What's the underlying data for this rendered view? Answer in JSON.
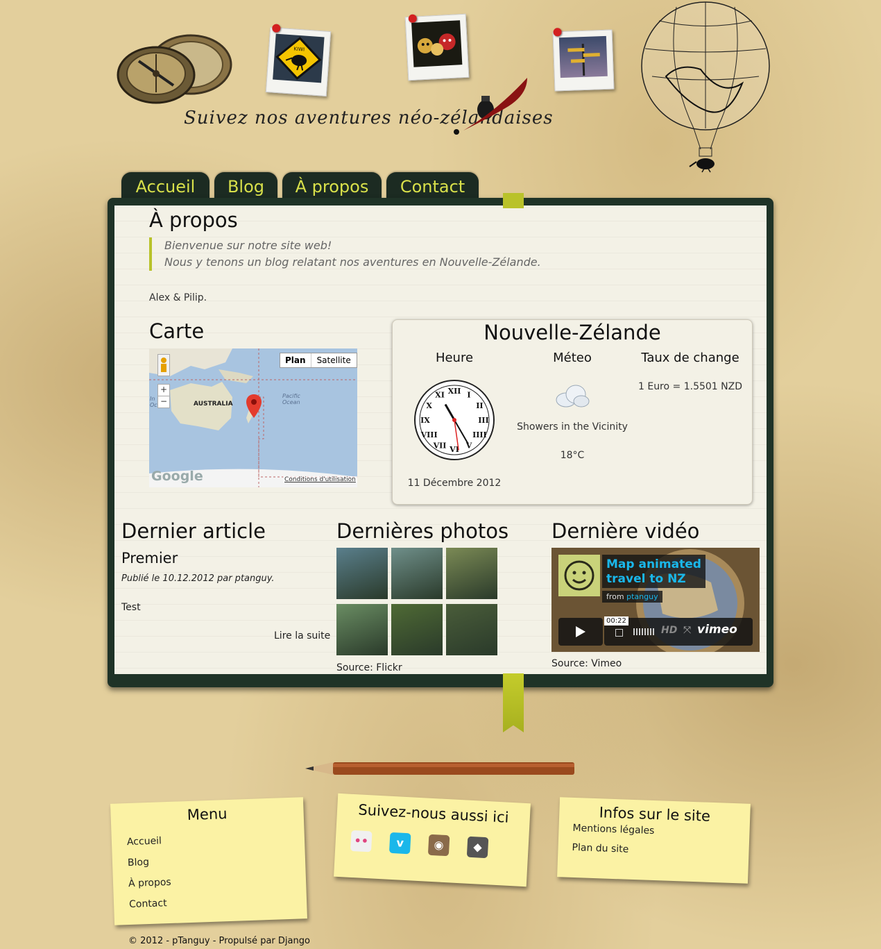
{
  "header": {
    "tagline": "Suivez nos aventures néo-zélandaises",
    "photo_sign_text": "KIWI"
  },
  "nav": {
    "tabs": [
      {
        "label": "Accueil"
      },
      {
        "label": "Blog"
      },
      {
        "label": "À propos"
      },
      {
        "label": "Contact"
      }
    ]
  },
  "about": {
    "title": "À propos",
    "quote_line1": "Bienvenue sur notre site web!",
    "quote_line2": "Nous y tenons un blog relatant nos aventures en Nouvelle-Zélande.",
    "signature": "Alex & Pilip."
  },
  "map": {
    "title": "Carte",
    "btn_plan": "Plan",
    "btn_satellite": "Satellite",
    "zoom_in": "+",
    "zoom_out": "−",
    "label_australia": "AUSTRALIA",
    "label_ocean_1": "Pacific",
    "label_ocean_2": "Ocean",
    "label_indian": "In",
    "label_indian2": "Oc",
    "google_logo": "Google",
    "terms": "Conditions d'utilisation"
  },
  "nz": {
    "title": "Nouvelle-Zélande",
    "col_time": "Heure",
    "col_weather": "Méteo",
    "col_rate": "Taux de change",
    "date": "11 Décembre 2012",
    "weather_desc": "Showers in the Vicinity",
    "temperature": "18°C",
    "rate": "1 Euro = 1.5501 NZD",
    "clock_hour": 12,
    "clock_minute": 0,
    "clock_second": 22
  },
  "article": {
    "section_title": "Dernier article",
    "title": "Premier",
    "meta": "Publié le 10.12.2012 par ptanguy.",
    "body": "Test",
    "read_more": "Lire la suite"
  },
  "photos": {
    "section_title": "Dernières photos",
    "source": "Source: Flickr",
    "thumb_colors": [
      "#5a7f8c",
      "#6f8f8a",
      "#7b8a55",
      "#6a8d63",
      "#4f6a35",
      "#4a5d3a"
    ]
  },
  "video": {
    "section_title": "Dernière vidéo",
    "title_line1": "Map animated",
    "title_line2": "travel to NZ",
    "from_label": "from",
    "author": "ptanguy",
    "time": "00:22",
    "hd": "HD",
    "brand": "vimeo",
    "source": "Source: Vimeo"
  },
  "footer": {
    "menu_title": "Menu",
    "menu_items": [
      "Accueil",
      "Blog",
      "À propos",
      "Contact"
    ],
    "social_title": "Suivez-nous aussi ici",
    "social_icons": [
      {
        "name": "flickr-icon",
        "color": "#f0f0f0",
        "glyph": "••"
      },
      {
        "name": "vimeo-icon",
        "color": "#1ab7ea",
        "glyph": "v"
      },
      {
        "name": "instagram-icon",
        "color": "#8a6a4a",
        "glyph": "◉"
      },
      {
        "name": "github-icon",
        "color": "#555555",
        "glyph": "◆"
      }
    ],
    "info_title": "Infos sur le site",
    "info_items": [
      "Mentions légales",
      "Plan du site"
    ],
    "copyright": "© 2012 - pTanguy - Propulsé par Django"
  },
  "colors": {
    "tab_bg": "#1c2b22",
    "tab_text": "#d8e04a",
    "accent_green": "#b8c22a",
    "note_yellow": "#fbf2a4"
  }
}
